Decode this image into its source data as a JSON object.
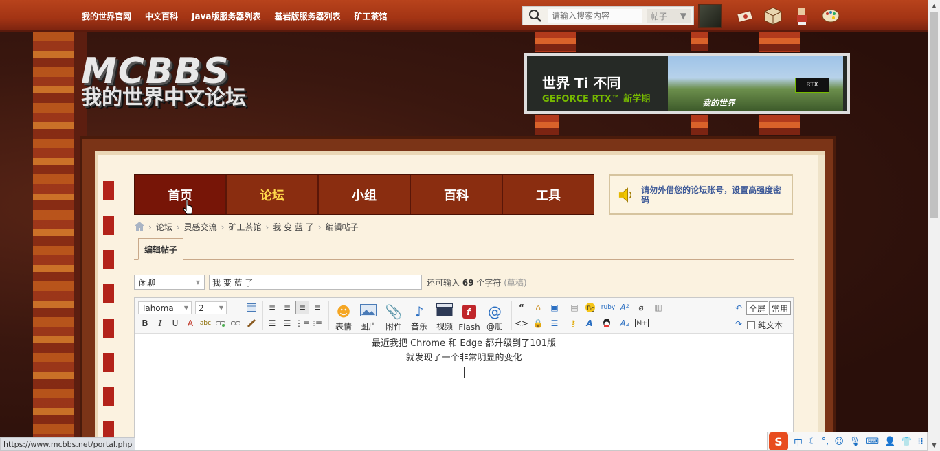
{
  "topnav": [
    "我的世界官网",
    "中文百科",
    "Java版服务器列表",
    "基岩版服务器列表",
    "矿工茶馆"
  ],
  "search": {
    "placeholder": "请输入搜索内容",
    "type": "帖子"
  },
  "logo": {
    "title": "MCBBS",
    "subtitle": "我的世界中文论坛"
  },
  "ad": {
    "line1": "世界 Ti 不同",
    "line2": "GEFORCE RTX™ 新学期",
    "game": "我的世界",
    "badge": "RTX"
  },
  "mainnav": [
    "首页",
    "论坛",
    "小组",
    "百科",
    "工具"
  ],
  "notice": "请勿外借您的论坛账号，设置高强度密码",
  "breadcrumb": [
    "论坛",
    "灵感交流",
    "矿工茶馆",
    "我 变 蓝 了",
    "编辑帖子"
  ],
  "tab": "编辑帖子",
  "post": {
    "type": "闲聊",
    "title": "我 变 蓝 了",
    "char_prefix": "还可输入",
    "char_count": "69",
    "char_suffix": "个字符",
    "draft": "(草稿)"
  },
  "editor": {
    "font": "Tahoma",
    "size": "2",
    "buttons": {
      "emoji": "表情",
      "image": "图片",
      "attach": "附件",
      "music": "音乐",
      "video": "视频",
      "flash": "Flash",
      "at": "@朋"
    },
    "fullscreen": "全屏",
    "common": "常用",
    "plaintext": "纯文本",
    "content": [
      "最近我把 Chrome 和 Edge 都升级到了101版",
      "就发现了一个非常明显的变化"
    ]
  },
  "status_url": "https://www.mcbbs.net/portal.php",
  "ime": {
    "logo": "S",
    "mode": "中"
  }
}
